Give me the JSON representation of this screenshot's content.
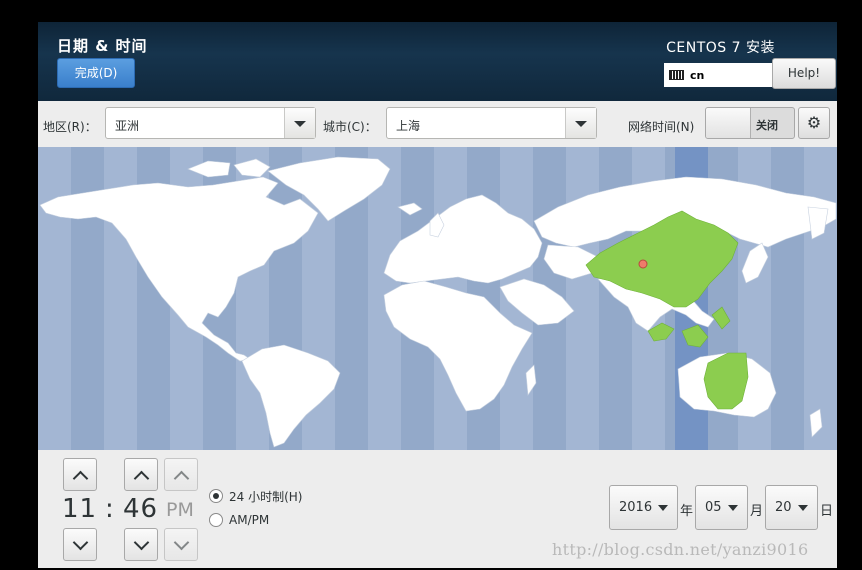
{
  "header": {
    "title": "日期 & 时间",
    "done_button": "完成(D)",
    "installer_title": "CENTOS 7 安装",
    "keyboard_layout": "cn",
    "help_button": "Help!"
  },
  "toolbar": {
    "region_label": "地区(R)：",
    "region_value": "亚洲",
    "city_label": "城市(C)：",
    "city_value": "上海",
    "network_time_label": "网络时间(N)",
    "network_time_state": "关闭"
  },
  "map": {
    "selected_city": "上海",
    "highlight_color": "#8ccd4f",
    "selected_zone_band_color": "#7493c4"
  },
  "time": {
    "hours": "11",
    "separator": ":",
    "minutes": "46",
    "ampm": "PM",
    "format_24h_label": "24 小时制(H)",
    "format_ampm_label": "AM/PM",
    "format_selected": "24h"
  },
  "date": {
    "year": "2016",
    "year_unit": "年",
    "month": "05",
    "month_unit": "月",
    "day": "20",
    "day_unit": "日"
  },
  "watermark": "http://blog.csdn.net/yanzi9016",
  "icons": {
    "keyboard": "keyboard-icon",
    "gear": "gear-icon",
    "arrow_up": "chevron-up-icon",
    "arrow_down": "chevron-down-icon",
    "map_pin": "map-pin-icon"
  }
}
